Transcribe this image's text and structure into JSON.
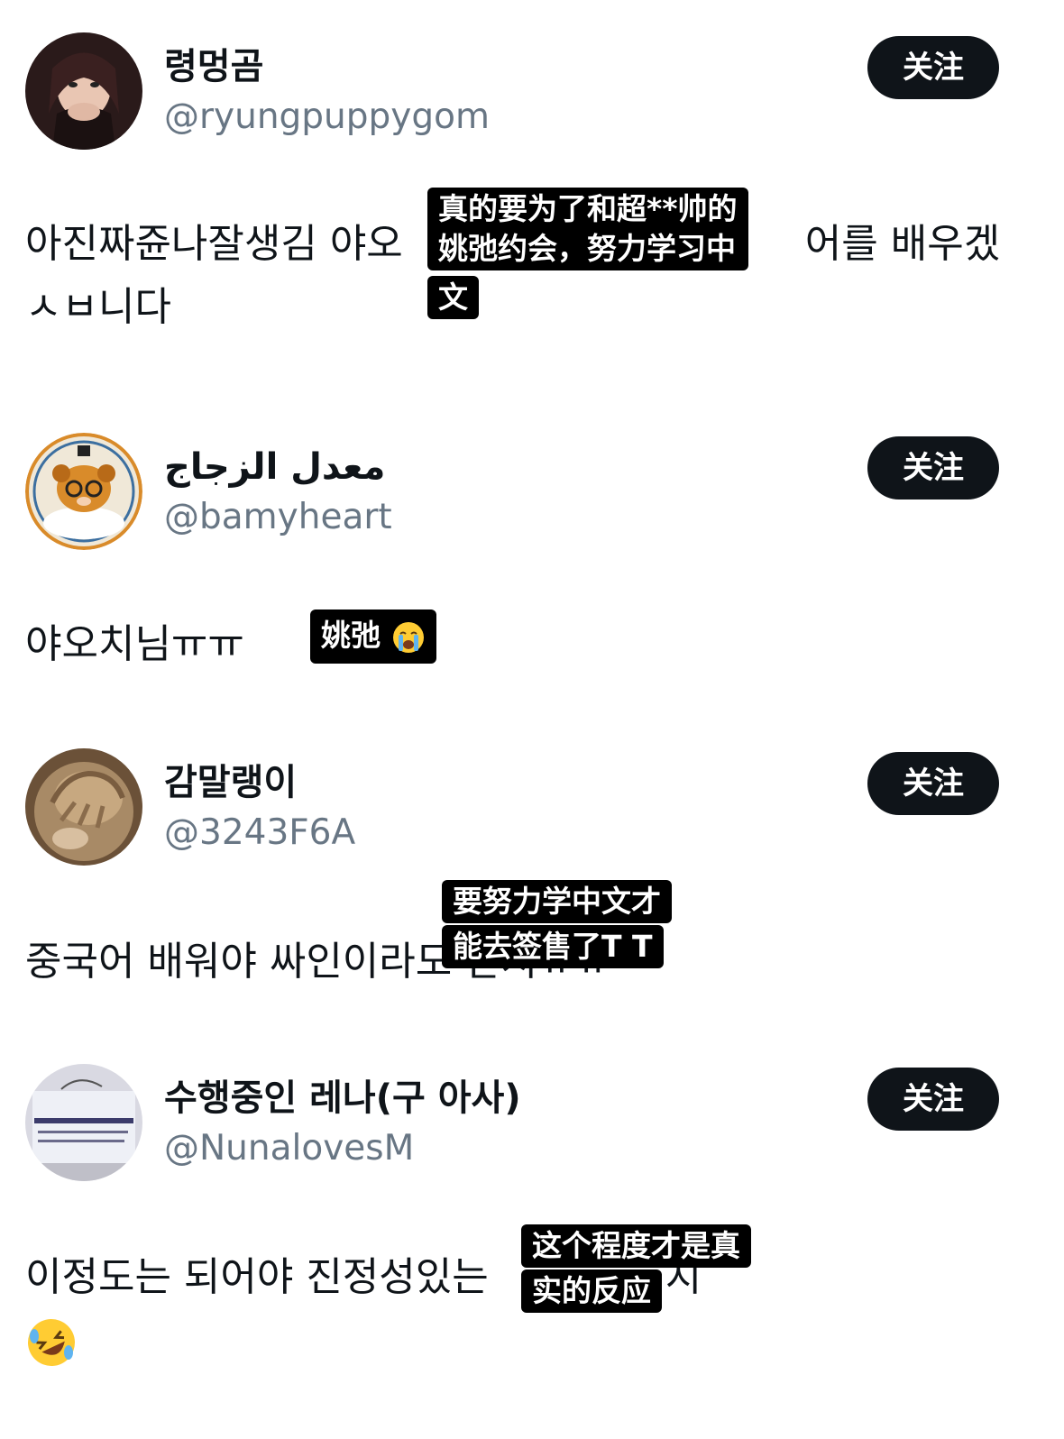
{
  "follow_label": "关注",
  "posts": [
    {
      "display_name": "령멍곰",
      "handle": "@ryungpuppygom",
      "text_lines": [
        "아진짜쥰나잘생김 야오",
        "어를 배우겠",
        "ㅅㅂ니다"
      ],
      "subtitle_lines": [
        "真的要为了和超**帅的",
        "姚弛约会，努力学习中",
        "文"
      ]
    },
    {
      "display_name": "معدل الزجاج",
      "handle": "@bamyheart",
      "text_lines": [
        "야오치님ㅠㅠ"
      ],
      "subtitle_lines": [
        "姚弛"
      ],
      "subtitle_emoji": "loudly-crying-face"
    },
    {
      "display_name": "감말랭이",
      "handle": "@3243F6A",
      "text_lines": [
        "중국어 배워야 싸인이라도 받지ㅠㅠ"
      ],
      "subtitle_lines": [
        "要努力学中文才",
        "能去签售了T T"
      ]
    },
    {
      "display_name": "수행중인 레나(구 아사)",
      "handle": "@NunalovesM",
      "text_lines": [
        "이정도는 되어야 진정성있는",
        "지"
      ],
      "text_emoji": "rolling-on-floor-laughing",
      "subtitle_lines": [
        "这个程度才是真",
        "实的反应"
      ]
    }
  ]
}
